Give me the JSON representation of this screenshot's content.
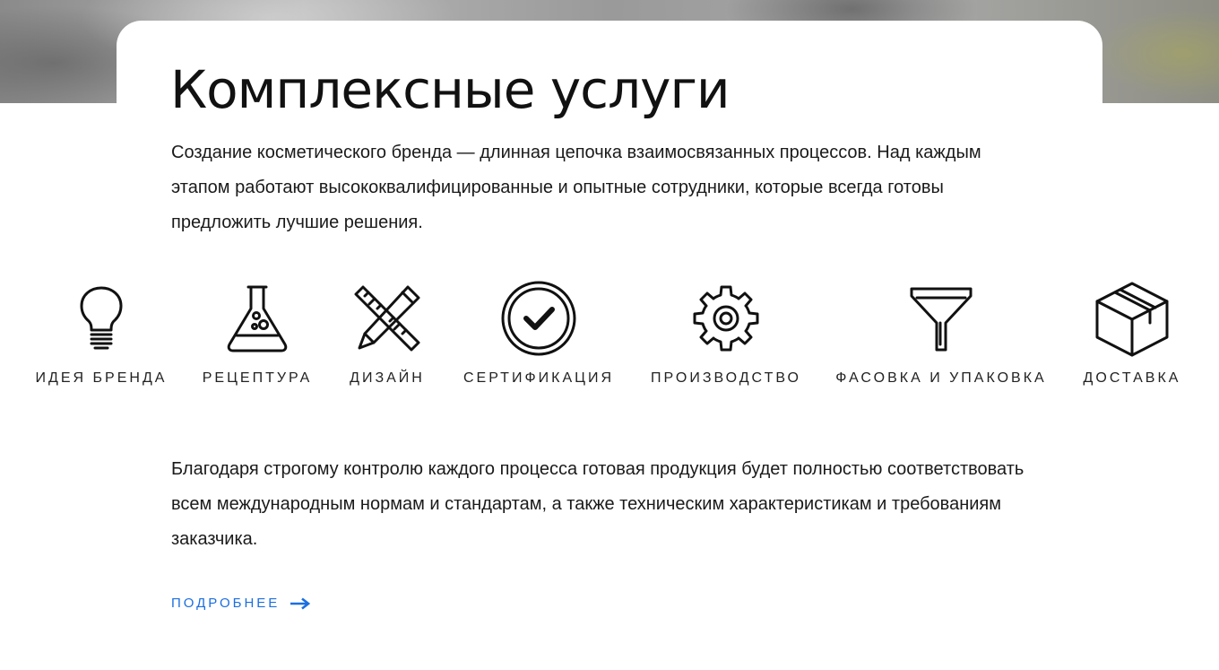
{
  "section": {
    "title": "Комплексные услуги",
    "intro": "Создание косметического бренда — длинная цепочка взаимосвязанных процессов. Над каждым этапом работают высококвалифицированные и опытные сотрудники, которые всегда готовы предложить лучшие решения.",
    "outro": "Благодаря строгому контролю каждого процесса готовая продукция будет полностью соответствовать всем международным нормам и стандартам, а также техническим характеристикам и требованиям заказчика.",
    "more_label": "ПОДРОБНЕЕ"
  },
  "steps": [
    {
      "label": "ИДЕЯ БРЕНДА",
      "icon": "lightbulb-icon"
    },
    {
      "label": "РЕЦЕПТУРА",
      "icon": "flask-icon"
    },
    {
      "label": "ДИЗАЙН",
      "icon": "ruler-pencil-icon"
    },
    {
      "label": "СЕРТИФИКАЦИЯ",
      "icon": "check-circle-icon"
    },
    {
      "label": "ПРОИЗВОДСТВО",
      "icon": "gear-icon"
    },
    {
      "label": "ФАСОВКА И УПАКОВКА",
      "icon": "funnel-icon"
    },
    {
      "label": "ДОСТАВКА",
      "icon": "box-icon"
    }
  ],
  "colors": {
    "accent": "#1b6fe0",
    "text": "#111111",
    "icon_stroke": "#111111"
  }
}
